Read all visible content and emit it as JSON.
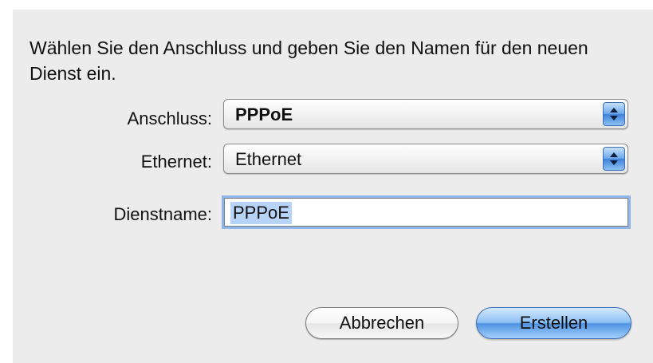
{
  "dialog": {
    "prompt": "Wählen Sie den Anschluss und geben Sie den Namen für den neuen Dienst ein.",
    "interface": {
      "label": "Anschluss:",
      "value": "PPPoE"
    },
    "ethernet": {
      "label": "Ethernet:",
      "value": "Ethernet"
    },
    "service_name": {
      "label": "Dienstname:",
      "value": "PPPoE"
    },
    "cancel_label": "Abbrechen",
    "create_label": "Erstellen"
  },
  "colors": {
    "accent": "#4f93e3",
    "selection": "#b7d3f7",
    "background": "#ececec"
  }
}
